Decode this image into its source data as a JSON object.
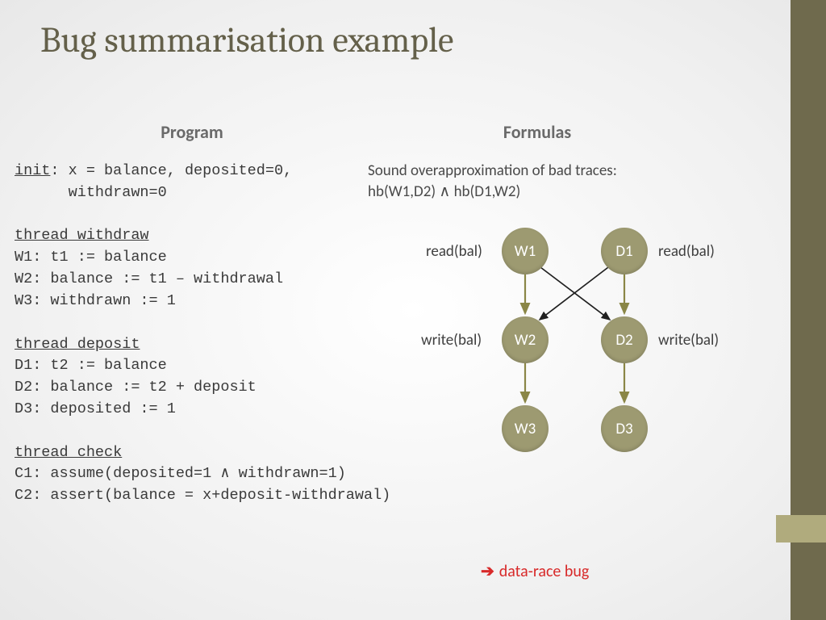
{
  "title": "Bug summarisation example",
  "program": {
    "header": "Program",
    "init_label": "init",
    "init_body": ": x = balance, deposited=0,\n      withdrawn=0",
    "withdraw_label": "thread withdraw",
    "withdraw_body": "W1: t1 := balance\nW2: balance := t1 – withdrawal\nW3: withdrawn := 1",
    "deposit_label": "thread deposit",
    "deposit_body": "D1: t2 := balance\nD2: balance := t2 + deposit\nD3: deposited := 1",
    "check_label": "thread check",
    "check_body": "C1: assume(deposited=1 ∧ withdrawn=1)\nC2: assert(balance = x+deposit-withdrawal)"
  },
  "formulas": {
    "header": "Formulas",
    "overapprox_line1": "Sound overapproximation of bad traces:",
    "overapprox_line2": "hb(W1,D2) ∧ hb(D1,W2)"
  },
  "diagram": {
    "nodes": {
      "W1": "W1",
      "W2": "W2",
      "W3": "W3",
      "D1": "D1",
      "D2": "D2",
      "D3": "D3"
    },
    "labels": {
      "read_left": "read(bal)",
      "read_right": "read(bal)",
      "write_left": "write(bal)",
      "write_right": "write(bal)"
    }
  },
  "conclusion": {
    "arrow": "➔",
    "text": "data-race bug"
  }
}
